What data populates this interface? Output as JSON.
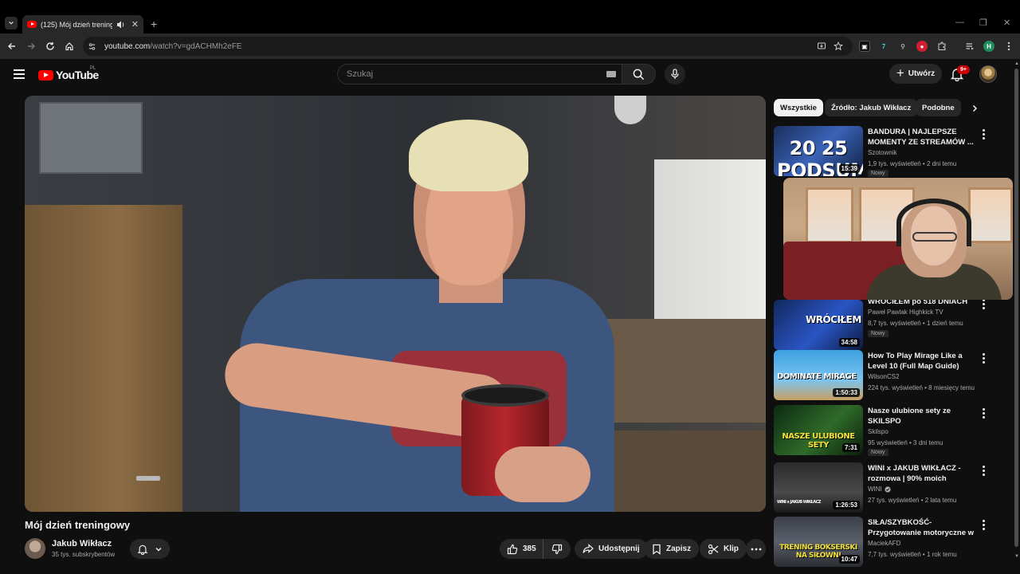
{
  "browser": {
    "tab_title": "(125) Mój dzień treningowy",
    "url_host": "youtube.com",
    "url_path": "/watch?v=gdACHMh2eFE",
    "new_tab": "+",
    "tab_close": "✕",
    "window_controls": [
      "—",
      "❐",
      "✕"
    ],
    "profile_initial": "H",
    "extension_labels": [
      "7"
    ]
  },
  "header": {
    "logo_text": "YouTube",
    "country_code": "PL",
    "search_placeholder": "Szukaj",
    "create_label": "Utwórz",
    "notifications_badge": "9+"
  },
  "video": {
    "title": "Mój dzień treningowy",
    "channel_name": "Jakub Wikłacz",
    "channel_subscribers": "35 tys. subskrybentów",
    "likes": "385",
    "share_label": "Udostępnij",
    "save_label": "Zapisz",
    "clip_label": "Klip"
  },
  "chips": [
    "Wszystkie",
    "Źródło: Jakub Wikłacz",
    "Podobne"
  ],
  "recommendations": [
    {
      "title": "BANDURA | NAJLEPSZE MOMENTY ZE STREAMÓW ...",
      "channel": "Szotownik",
      "meta": "1,9 tys. wyświetleń • 2 dni temu",
      "badge": "Nowy",
      "duration": "15:39",
      "thumb_text": "20 25 PODSUMOWANIE",
      "verified": false
    },
    {
      "title": "WRÓCIŁEM po 518 DNIACH",
      "channel": "Paweł Pawlak Highkick TV",
      "meta": "8,7 tys. wyświetleń • 1 dzień temu",
      "badge": "Nowy",
      "duration": "34:58",
      "thumb_text": "WRÓCIŁEM",
      "verified": false
    },
    {
      "title": "How To Play Mirage Like a Level 10 (Full Map Guide)",
      "channel": "WilsonCS2",
      "meta": "224 tys. wyświetleń • 8 miesięcy temu",
      "badge": "",
      "duration": "1:50:33",
      "thumb_text": "DOMINATE MIRAGE",
      "verified": false
    },
    {
      "title": "Nasze ulubione sety ze SKILSPO",
      "channel": "Skilspo",
      "meta": "95 wyświetleń • 3 dni temu",
      "badge": "Nowy",
      "duration": "7:31",
      "thumb_text": "NASZE ULUBIONE SETY",
      "verified": false
    },
    {
      "title": "WINI x JAKUB WIKŁACZ - rozmowa | 90% moich kontuzji...",
      "channel": "WINI",
      "meta": "27 tys. wyświetleń • 2 lata temu",
      "badge": "",
      "duration": "1:26:53",
      "thumb_text": "WINI x JAKUB WIKŁACZ",
      "verified": true
    },
    {
      "title": "SIŁA/SZYBKOŚĆ- Przygotowanie motoryczne w ...",
      "channel": "MaciekAFD",
      "meta": "7,7 tys. wyświetleń • 1 rok temu",
      "badge": "",
      "duration": "10:47",
      "thumb_text": "TRENING BOKSERSKI NA SIŁOWNI",
      "verified": false
    }
  ],
  "colors": {
    "brand_red": "#ff0000",
    "background": "#0f0f0f",
    "pill": "#272727",
    "badge_red": "#cc0000"
  }
}
